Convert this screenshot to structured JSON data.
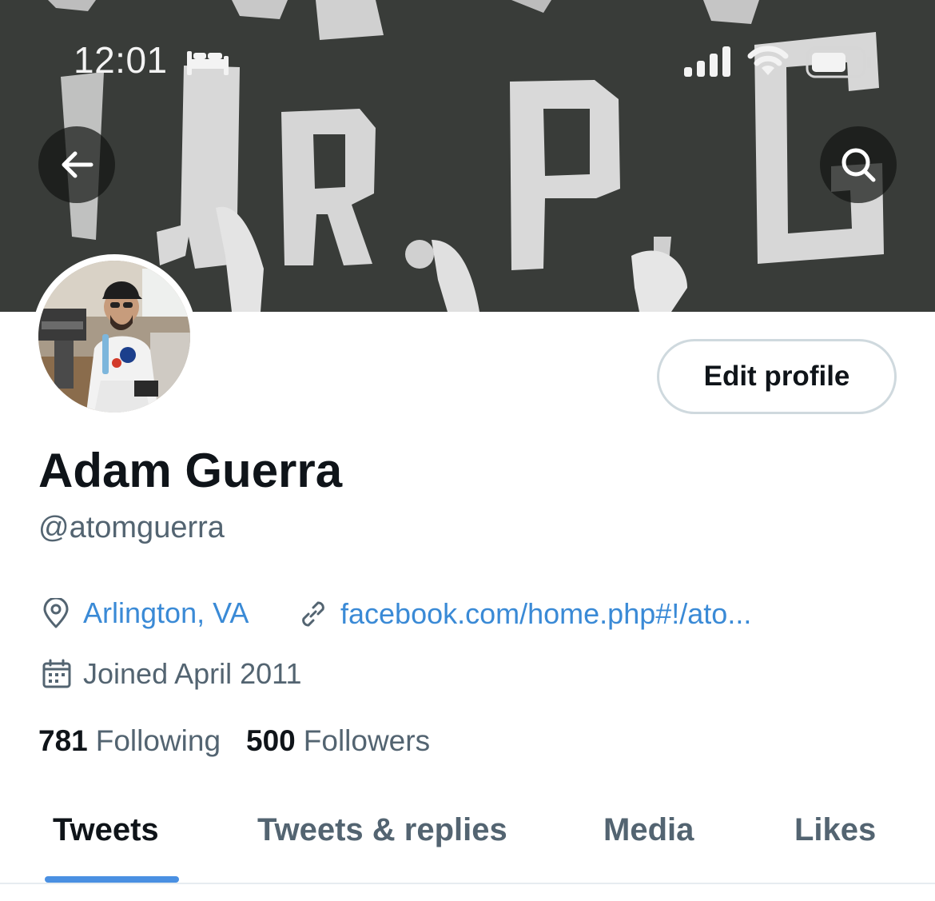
{
  "status_bar": {
    "time": "12:01",
    "icons": [
      "bed-icon",
      "cellular-signal-icon",
      "wifi-icon",
      "battery-icon"
    ]
  },
  "header": {
    "back_icon": "arrow-left-icon",
    "search_icon": "search-icon"
  },
  "profile": {
    "name": "Adam Guerra",
    "handle": "@atomguerra",
    "edit_label": "Edit profile",
    "location": "Arlington, VA",
    "website": "facebook.com/home.php#!/ato...",
    "joined": "Joined April 2011",
    "following_count": "781",
    "following_label": "Following",
    "followers_count": "500",
    "followers_label": "Followers"
  },
  "tabs": [
    {
      "label": "Tweets",
      "active": true
    },
    {
      "label": "Tweets & replies",
      "active": false
    },
    {
      "label": "Media",
      "active": false
    },
    {
      "label": "Likes",
      "active": false
    }
  ],
  "colors": {
    "accent": "#4a90e2",
    "link": "#3a8ad6",
    "text_primary": "#0f1419",
    "text_secondary": "#536471",
    "border": "#cfd9de"
  }
}
